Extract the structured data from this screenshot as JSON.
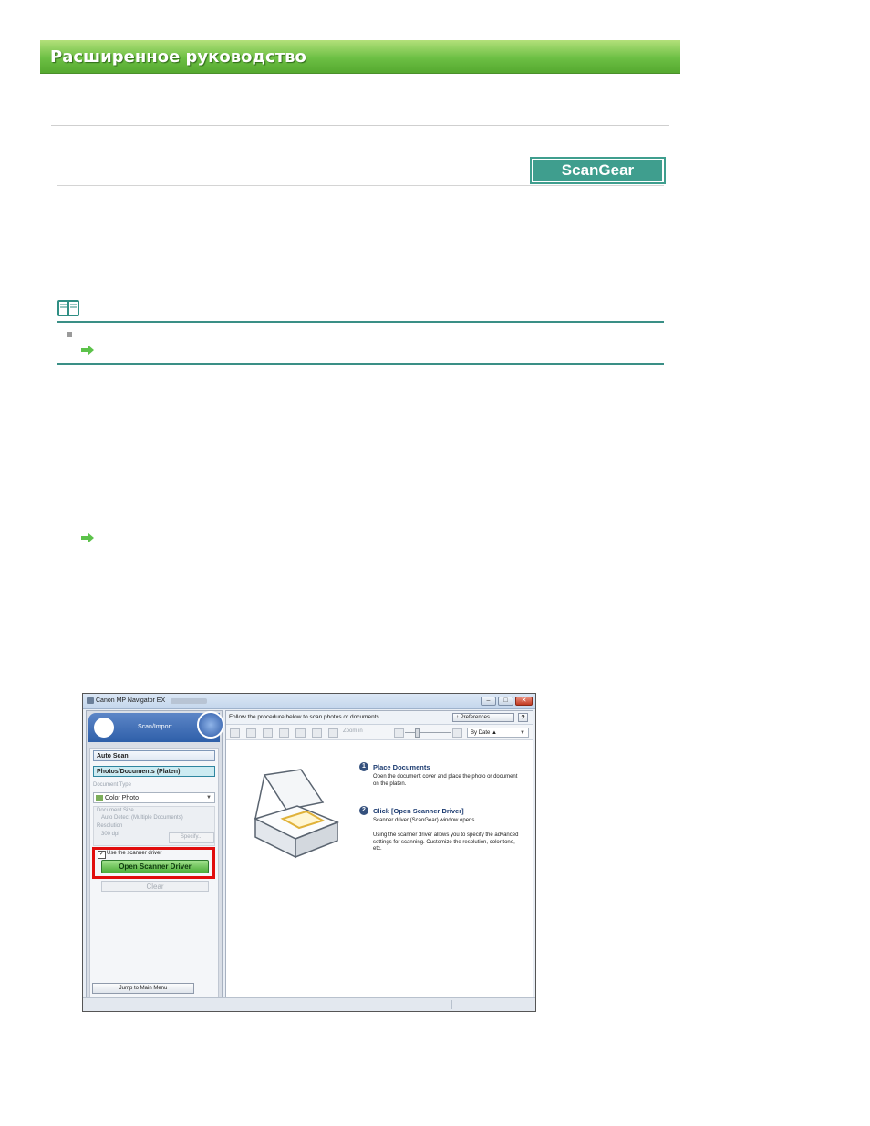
{
  "banner": {
    "title": "Расширенное руководство"
  },
  "badge": {
    "label": "ScanGear"
  },
  "window": {
    "title": "Canon MP Navigator EX",
    "left_pane": {
      "header_label": "Scan/Import",
      "items": [
        {
          "label": "Auto Scan"
        },
        {
          "label": "Photos/Documents (Platen)"
        }
      ],
      "document_type_label": "Document Type",
      "document_type_value": "Color Photo",
      "document_size_label": "Document Size",
      "document_size_value": "Auto Detect (Multiple Documents)",
      "resolution_label": "Resolution",
      "resolution_value": "300 dpi",
      "specify_label": "Specify...",
      "use_scanner_driver_label": "Use the scanner driver",
      "open_scanner_driver_label": "Open Scanner Driver",
      "clear_label": "Clear",
      "jump_label": "Jump to Main Menu"
    },
    "right_pane": {
      "instruction": "Follow the procedure below to scan photos or documents.",
      "preferences_label": "Preferences",
      "help_label": "?",
      "zoom_label": "Zoom in",
      "sort_label": "By Date",
      "steps": [
        {
          "number": "1",
          "title": "Place Documents",
          "text": "Open the document cover and place the photo or document on the platen."
        },
        {
          "number": "2",
          "title": "Click [Open Scanner Driver]",
          "text": "Scanner driver (ScanGear) window opens."
        }
      ],
      "step2_extra": "Using the scanner driver allows you to specify the advanced settings for scanning. Customize the resolution, color tone, etc."
    }
  },
  "colors": {
    "banner_green": "#6cbf44",
    "accent_teal": "#3f9e8e",
    "highlight_red": "#e10d0d",
    "button_green": "#4dae3a"
  }
}
